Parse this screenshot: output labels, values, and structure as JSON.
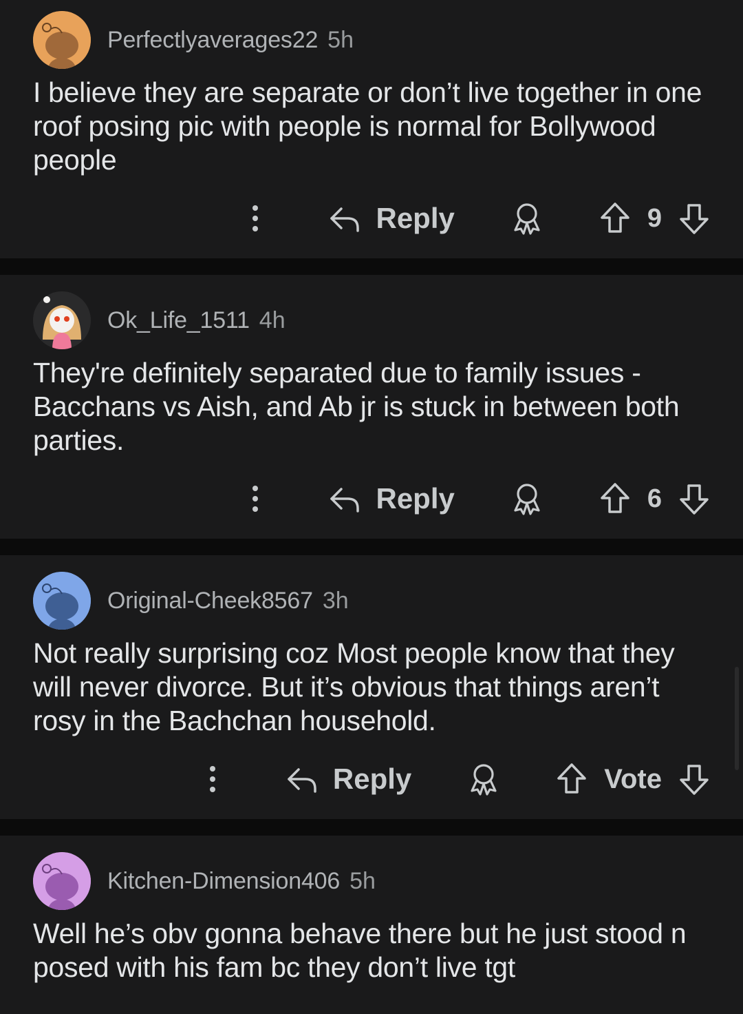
{
  "comments": [
    {
      "username": "Perfectlyaverages22",
      "age": "5h",
      "avatar_color": "#e8a25a",
      "body": "I believe they are separate or don’t live together in one roof posing pic with people is normal for Bollywood people",
      "reply_label": "Reply",
      "vote_count": "9"
    },
    {
      "username": "Ok_Life_1511",
      "age": "4h",
      "avatar_color": "#2a2a2b",
      "body": "They're definitely separated due to family issues - Bacchans vs Aish, and Ab jr is stuck in between both parties.",
      "reply_label": "Reply",
      "vote_count": "6"
    },
    {
      "username": "Original-Cheek8567",
      "age": "3h",
      "avatar_color": "#7fa6e8",
      "body": "Not really surprising coz Most people know that they will never divorce. But it’s obvious that things aren’t rosy in the Bachchan household.",
      "reply_label": "Reply",
      "vote_count": "Vote"
    },
    {
      "username": "Kitchen-Dimension406",
      "age": "5h",
      "avatar_color": "#d59ee6",
      "body": "Well he’s obv gonna behave there but he just stood n posed with his fam bc they don’t live tgt"
    }
  ],
  "icons": {
    "more": "more-vertical-icon",
    "reply": "reply-arrow-icon",
    "award": "award-icon",
    "upvote": "upvote-arrow-icon",
    "downvote": "downvote-arrow-icon"
  },
  "colors": {
    "background": "#0b0b0b",
    "card": "#1a1a1b",
    "text": "#e4e6e8",
    "meta": "#b0b3b6"
  }
}
